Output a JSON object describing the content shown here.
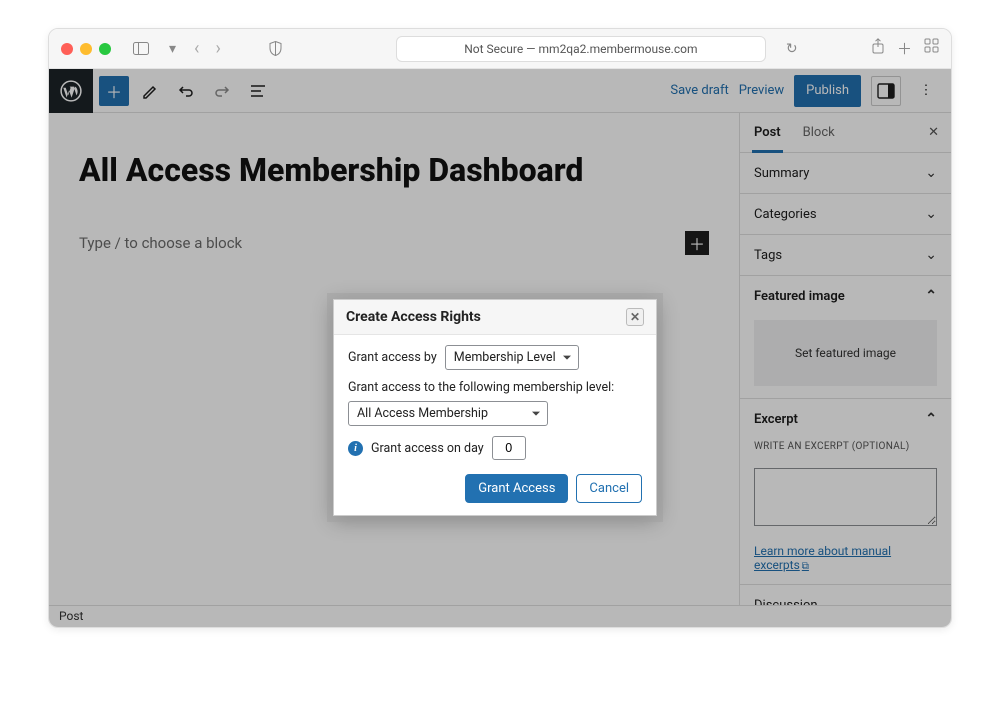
{
  "browser": {
    "url_label": "Not Secure — mm2qa2.membermouse.com"
  },
  "editor": {
    "save_draft": "Save draft",
    "preview": "Preview",
    "publish": "Publish",
    "page_title": "All Access Membership Dashboard",
    "block_placeholder": "Type / to choose a block",
    "footer_status": "Post"
  },
  "sidebar": {
    "tab_post": "Post",
    "tab_block": "Block",
    "panels": {
      "summary": "Summary",
      "categories": "Categories",
      "tags": "Tags",
      "featured_image": "Featured image",
      "featured_image_button": "Set featured image",
      "excerpt": "Excerpt",
      "excerpt_label": "WRITE AN EXCERPT (OPTIONAL)",
      "excerpt_link": "Learn more about manual excerpts",
      "discussion": "Discussion"
    }
  },
  "modal": {
    "title": "Create Access Rights",
    "grant_by_label": "Grant access by",
    "grant_by_value": "Membership Level",
    "following_label": "Grant access to the following membership level:",
    "level_value": "All Access Membership",
    "day_label": "Grant access on day",
    "day_value": "0",
    "grant_button": "Grant Access",
    "cancel_button": "Cancel"
  }
}
